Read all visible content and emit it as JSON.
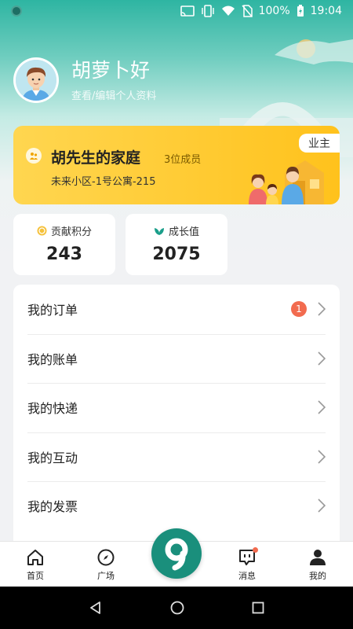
{
  "status": {
    "battery": "100%",
    "time": "19:04"
  },
  "profile": {
    "greeting": "胡萝卜好",
    "subtitle": "查看/编辑个人资料"
  },
  "family": {
    "name": "胡先生的家庭",
    "members": "3位成员",
    "address": "未来小区-1号公寓-215",
    "badge": "业主"
  },
  "stats": [
    {
      "label": "贡献积分",
      "value": "243",
      "icon": "coin-icon"
    },
    {
      "label": "成长值",
      "value": "2075",
      "icon": "sprout-icon"
    }
  ],
  "menu": [
    {
      "label": "我的订单",
      "badge": "1"
    },
    {
      "label": "我的账单"
    },
    {
      "label": "我的快递"
    },
    {
      "label": "我的互动"
    },
    {
      "label": "我的发票"
    }
  ],
  "tabs": [
    {
      "label": "首页",
      "icon": "home-icon"
    },
    {
      "label": "广场",
      "icon": "compass-icon"
    },
    {
      "label": "",
      "icon": "center-logo-icon"
    },
    {
      "label": "消息",
      "icon": "message-icon"
    },
    {
      "label": "我的",
      "icon": "user-icon"
    }
  ],
  "colors": {
    "brand": "#1a8f7c",
    "accent": "#ffc21c",
    "badge": "#f26b4f"
  }
}
